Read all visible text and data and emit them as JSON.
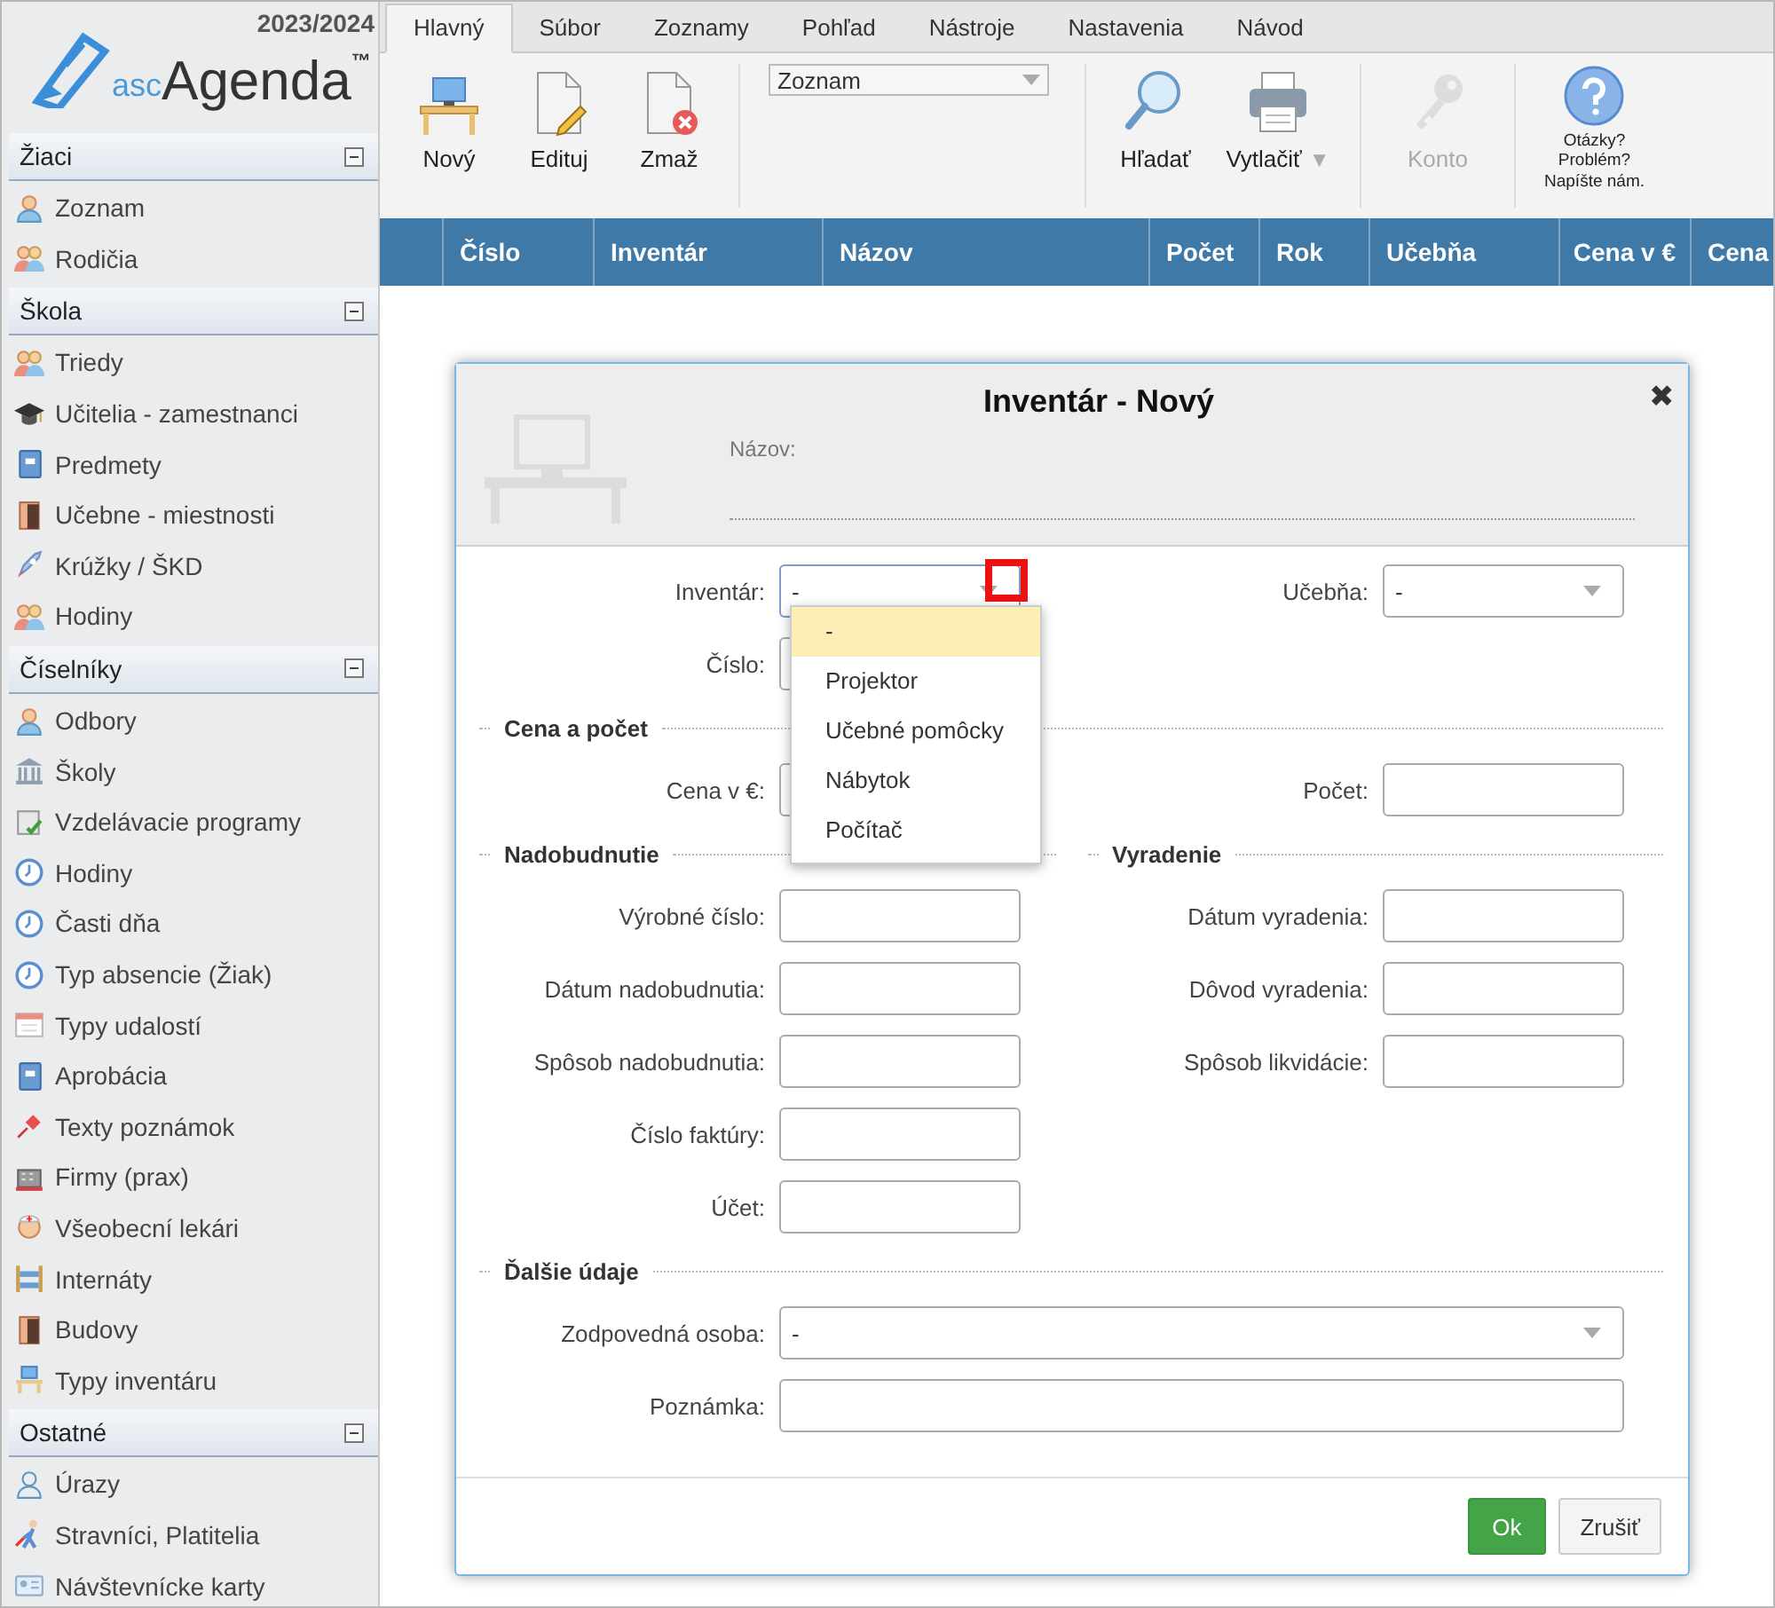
{
  "sidebar": {
    "year": "2023/2024",
    "logo": {
      "prefix": "asc",
      "name": "Agenda",
      "mark": "™"
    },
    "groups": [
      {
        "title": "Žiaci",
        "expanded": true,
        "items": [
          "Zoznam",
          "Rodičia"
        ]
      },
      {
        "title": "Škola",
        "expanded": true,
        "items": [
          "Triedy",
          "Učitelia - zamestnanci",
          "Predmety",
          "Učebne - miestnosti",
          "Krúžky / ŠKD",
          "Hodiny"
        ]
      },
      {
        "title": "Číselníky",
        "expanded": true,
        "items": [
          "Odbory",
          "Školy",
          "Vzdelávacie programy",
          "Hodiny",
          "Časti dňa",
          "Typ absencie (Žiak)",
          "Typy udalostí",
          "Aprobácia",
          "Texty poznámok",
          "Firmy (prax)",
          "Všeobecní lekári",
          "Internáty",
          "Budovy",
          "Typy inventáru"
        ]
      },
      {
        "title": "Ostatné",
        "expanded": true,
        "items": [
          "Úrazy",
          "Stravníci, Platitelia",
          "Návštevnícke karty"
        ]
      }
    ]
  },
  "tabs": [
    {
      "label": "Hlavný",
      "selected": true
    },
    {
      "label": "Súbor",
      "selected": false
    },
    {
      "label": "Zoznamy",
      "selected": false
    },
    {
      "label": "Pohľad",
      "selected": false
    },
    {
      "label": "Nástroje",
      "selected": false
    },
    {
      "label": "Nastavenia",
      "selected": false
    },
    {
      "label": "Návod",
      "selected": false
    }
  ],
  "ribbon": {
    "edit_buttons": [
      {
        "label": "Nový",
        "disabled": false
      },
      {
        "label": "Edituj",
        "disabled": false
      },
      {
        "label": "Zmaž",
        "disabled": false
      }
    ],
    "list_select": {
      "value": "Zoznam"
    },
    "tool_buttons": [
      {
        "label": "Hľadať",
        "disabled": false
      },
      {
        "label": "Vytlačiť",
        "disabled": false,
        "menu": "▼"
      }
    ],
    "account_button": {
      "label": "Konto",
      "disabled": true
    },
    "help": {
      "lines": [
        "Otázky?",
        "Problém?",
        "Napíšte nám."
      ]
    }
  },
  "table": {
    "columns": [
      "",
      "Číslo",
      "Inventár",
      "Názov",
      "Počet",
      "Rok",
      "Učebňa",
      "Cena v €",
      "Cena"
    ]
  },
  "dialog": {
    "title": "Inventár - Nový",
    "name_label": "Názov:",
    "close": "✖",
    "form": [
      {
        "kind": "row",
        "fields": [
          {
            "label": "Inventár:",
            "kind": "select",
            "value": "-",
            "open": true,
            "highlighted": true,
            "options": [
              {
                "label": "-",
                "selected": true
              },
              {
                "label": "Projektor",
                "selected": false
              },
              {
                "label": "Učebné pomôcky",
                "selected": false
              },
              {
                "label": "Nábytok",
                "selected": false
              },
              {
                "label": "Počítač",
                "selected": false
              }
            ]
          },
          {
            "label": "Učebňa:",
            "kind": "select",
            "value": "-"
          }
        ]
      },
      {
        "kind": "row",
        "fields": [
          {
            "label": "Číslo:",
            "kind": "input"
          }
        ]
      },
      {
        "kind": "heading",
        "titles": [
          "Cena a počet"
        ]
      },
      {
        "kind": "row",
        "fields": [
          {
            "label": "Cena v €:",
            "kind": "input"
          },
          {
            "label": "Počet:",
            "kind": "input"
          }
        ]
      },
      {
        "kind": "heading",
        "titles": [
          "Nadobudnutie",
          "Vyradenie"
        ]
      },
      {
        "kind": "row",
        "fields": [
          {
            "label": "Výrobné číslo:",
            "kind": "input"
          },
          {
            "label": "Dátum vyradenia:",
            "kind": "input"
          }
        ]
      },
      {
        "kind": "row",
        "fields": [
          {
            "label": "Dátum nadobudnutia:",
            "kind": "input"
          },
          {
            "label": "Dôvod vyradenia:",
            "kind": "input"
          }
        ]
      },
      {
        "kind": "row",
        "fields": [
          {
            "label": "Spôsob nadobudnutia:",
            "kind": "input"
          },
          {
            "label": "Spôsob likvidácie:",
            "kind": "input"
          }
        ]
      },
      {
        "kind": "row",
        "fields": [
          {
            "label": "Číslo faktúry:",
            "kind": "input"
          }
        ]
      },
      {
        "kind": "row",
        "fields": [
          {
            "label": "Účet:",
            "kind": "input"
          }
        ]
      },
      {
        "kind": "heading",
        "titles": [
          "Ďalšie údaje"
        ]
      },
      {
        "kind": "wide",
        "fields": [
          {
            "label": "Zodpovedná osoba:",
            "kind": "select",
            "value": "-"
          }
        ]
      },
      {
        "kind": "wide",
        "fields": [
          {
            "label": "Poznámka:",
            "kind": "input"
          }
        ]
      }
    ],
    "buttons": [
      {
        "label": "Ok",
        "kind": "primary"
      },
      {
        "label": "Zrušiť",
        "kind": "secondary"
      }
    ]
  }
}
